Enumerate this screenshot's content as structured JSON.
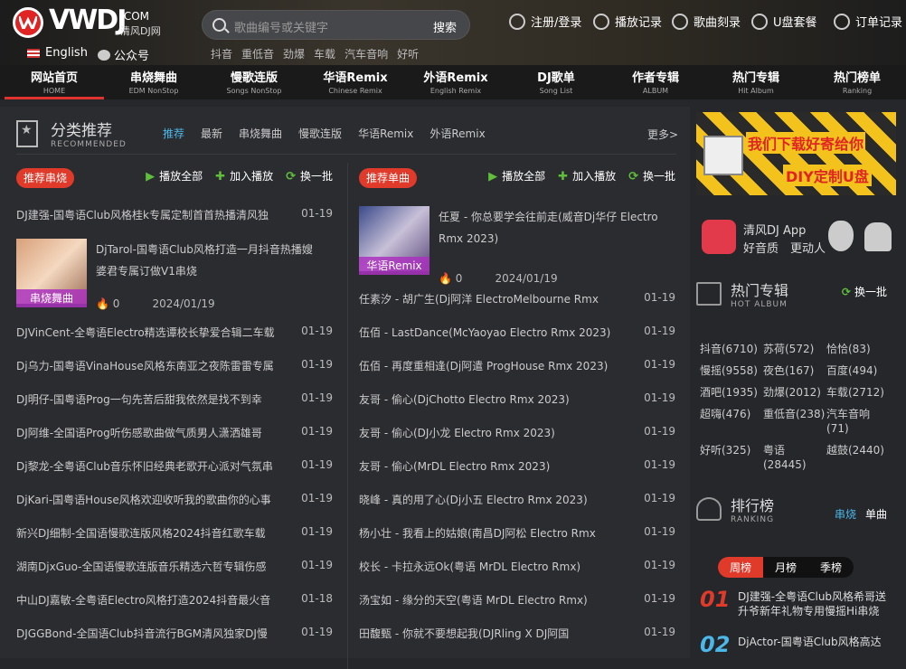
{
  "header": {
    "logo_text": "VWDJ",
    "logo_com": ".COM",
    "logo_cn": "清风DJ网",
    "lang": "English",
    "wechat": "公众号",
    "search_placeholder": "歌曲编号或关键字",
    "search_button": "搜索",
    "hot_keywords": [
      "抖音",
      "重低音",
      "劲爆",
      "车载",
      "汽车音响",
      "好听"
    ],
    "links": [
      {
        "label": "注册/登录",
        "icon": "user-icon"
      },
      {
        "label": "播放记录",
        "icon": "play-history-icon"
      },
      {
        "label": "歌曲刻录",
        "icon": "disc-icon"
      },
      {
        "label": "U盘套餐",
        "icon": "usb-icon"
      },
      {
        "label": "订单记录",
        "icon": "order-icon"
      }
    ]
  },
  "menu": [
    {
      "cn": "网站首页",
      "en": "HOME"
    },
    {
      "cn": "串烧舞曲",
      "en": "EDM NonStop"
    },
    {
      "cn": "慢歌连版",
      "en": "Songs NonStop"
    },
    {
      "cn": "华语Remix",
      "en": "Chinese Remix"
    },
    {
      "cn": "外语Remix",
      "en": "English Remix"
    },
    {
      "cn": "DJ歌单",
      "en": "Song List"
    },
    {
      "cn": "作者专辑",
      "en": "ALBUM"
    },
    {
      "cn": "热门专辑",
      "en": "Hit Album"
    },
    {
      "cn": "热门榜单",
      "en": "Ranking"
    }
  ],
  "section": {
    "title_cn": "分类推荐",
    "title_en": "RECOMMENDED",
    "tabs": [
      "推荐",
      "最新",
      "串烧舞曲",
      "慢歌连版",
      "华语Remix",
      "外语Remix"
    ],
    "more": "更多>"
  },
  "left": {
    "tag": "推荐串烧",
    "play_all": "播放全部",
    "add_play": "加入播放",
    "refresh": "换一批",
    "first": {
      "title": "DJ建强-国粤语Club风格桂k专属定制首首热播清风独",
      "date": "01-19"
    },
    "feature": {
      "title": "DjTarol-国粤语Club风格打造一月抖音热播嫂",
      "title2": "婆君专属订做V1串烧",
      "badge": "串烧舞曲",
      "plays": "0",
      "date": "2024/01/19"
    },
    "rows": [
      {
        "title": "DJVinCent-全粤语Electro精选谭校长挚爱合辑二车载",
        "date": "01-19"
      },
      {
        "title": "Dj乌力-国粤语VinaHouse风格东南亚之夜陈雷雷专属",
        "date": "01-19"
      },
      {
        "title": "DJ明仔-国粤语Prog一句先苦后甜我依然是找不到幸",
        "date": "01-19"
      },
      {
        "title": "DJ阿维-全国语Prog听伤感歌曲做气质男人潇洒雄哥",
        "date": "01-19"
      },
      {
        "title": "Dj黎龙-全粤语Club音乐怀旧经典老歌开心派对气氛串",
        "date": "01-19"
      },
      {
        "title": "DjKari-国粤语House风格欢迎收听我的歌曲你的心事",
        "date": "01-19"
      },
      {
        "title": "新兴DJ细制-全国语慢歌连版风格2024抖音红歌车载",
        "date": "01-19"
      },
      {
        "title": "湖南DjxGuo-全国语慢歌连版音乐精选六哲专辑伤感",
        "date": "01-19"
      },
      {
        "title": "中山DJ嘉敏-全粤语Electro风格打造2024抖音最火音",
        "date": "01-18"
      },
      {
        "title": "DJGGBond-全国语Club抖音流行BGM清风独家DJ慢",
        "date": "01-19"
      }
    ]
  },
  "right_col": {
    "tag": "推荐单曲",
    "play_all": "播放全部",
    "add_play": "加入播放",
    "refresh": "换一批",
    "feature": {
      "title": "任夏 - 你总要学会往前走(威音Dj华仔 Electro",
      "title2": "Rmx 2023)",
      "badge": "华语Remix",
      "plays": "0",
      "date": "2024/01/19"
    },
    "rows": [
      {
        "title": "任素汐 - 胡广生(Dj阿洋 ElectroMelbourne Rmx",
        "date": "01-19"
      },
      {
        "title": "伍佰 - LastDance(McYaoyao Electro Rmx 2023)",
        "date": "01-19"
      },
      {
        "title": "伍佰 - 再度重相逢(Dj阿遣 ProgHouse Rmx 2023)",
        "date": "01-19"
      },
      {
        "title": "友哥 - 偷心(DjChotto Electro Rmx 2023)",
        "date": "01-19"
      },
      {
        "title": "友哥 - 偷心(DJ小龙 Electro Rmx 2023)",
        "date": "01-19"
      },
      {
        "title": "友哥 - 偷心(MrDL Electro Rmx 2023)",
        "date": "01-19"
      },
      {
        "title": "晓峰 - 真的用了心(Dj小五 Electro Rmx 2023)",
        "date": "01-19"
      },
      {
        "title": "杨小壮 - 我看上的姑娘(南昌DJ阿松 Electro Rmx",
        "date": "01-19"
      },
      {
        "title": "校长 - 卡拉永远Ok(粤语 MrDL Electro Rmx)",
        "date": "01-19"
      },
      {
        "title": "汤宝如 - 缘分的天空(粤语 MrDL Electro Rmx)",
        "date": "01-19"
      },
      {
        "title": "田馥甄 - 你就不要想起我(DJRling X DJ阿国",
        "date": "01-19"
      }
    ]
  },
  "sidebar": {
    "ad_line1": "我们下载好寄给你",
    "ad_line2": "DIY定制U盘",
    "app_line1": "清风DJ App",
    "app_line2": "好音质　更动人",
    "hot_album": {
      "cn": "热门专辑",
      "en": "HOT ALBUM",
      "refresh": "换一批",
      "items": [
        "抖音(6710)",
        "苏荷(572)",
        "恰恰(83)",
        "慢摇(9558)",
        "夜色(167)",
        "百度(494)",
        "酒吧(1935)",
        "劲爆(2012)",
        "车载(2712)",
        "超嗨(476)",
        "重低音(238)",
        "汽车音响(71)",
        "好听(325)",
        "粤语(28445)",
        "越鼓(2440)"
      ]
    },
    "ranking": {
      "cn": "排行榜",
      "en": "RANKING",
      "tabs": [
        "串烧",
        "单曲"
      ],
      "period_tabs": [
        "周榜",
        "月榜",
        "季榜"
      ],
      "items": [
        {
          "num": "01",
          "title": "DJ建强-全粤语Club风格希哥送升爷新年礼物专用慢摇Hi串烧"
        },
        {
          "num": "02",
          "title": "DjActor-国粤语Club风格高达"
        }
      ]
    }
  },
  "colors": {
    "accent": "#e03a2b",
    "active_tab": "#4cb8ea",
    "green": "#5fbf3b"
  }
}
